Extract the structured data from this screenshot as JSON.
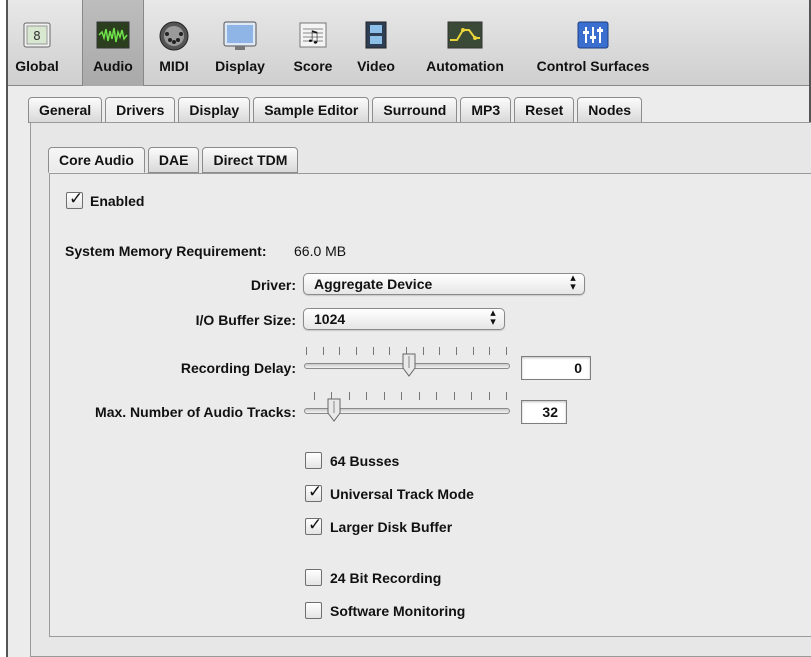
{
  "toolbar": {
    "items": [
      {
        "label": "Global",
        "icon": "global-icon"
      },
      {
        "label": "Audio",
        "icon": "audio-waveform-icon",
        "selected": true
      },
      {
        "label": "MIDI",
        "icon": "midi-connector-icon"
      },
      {
        "label": "Display",
        "icon": "display-monitor-icon"
      },
      {
        "label": "Score",
        "icon": "score-notes-icon"
      },
      {
        "label": "Video",
        "icon": "video-film-icon"
      },
      {
        "label": "Automation",
        "icon": "automation-curve-icon"
      },
      {
        "label": "Control Surfaces",
        "icon": "control-surface-icon"
      }
    ]
  },
  "tabs": {
    "main": [
      "General",
      "Drivers",
      "Display",
      "Sample Editor",
      "Surround",
      "MP3",
      "Reset",
      "Nodes"
    ],
    "main_active": "Drivers",
    "sub": [
      "Core Audio",
      "DAE",
      "Direct TDM"
    ],
    "sub_active": "Core Audio"
  },
  "core_audio": {
    "enabled": {
      "label": "Enabled",
      "checked": true
    },
    "memory_label": "System Memory Requirement:",
    "memory_value": "66.0 MB",
    "driver": {
      "label": "Driver:",
      "value": "Aggregate Device"
    },
    "buffer": {
      "label": "I/O Buffer Size:",
      "value": "1024"
    },
    "recording_delay": {
      "label": "Recording Delay:",
      "value": "0",
      "level": 0.5
    },
    "max_tracks": {
      "label": "Max. Number of Audio Tracks:",
      "value": "32",
      "level": 0.1
    },
    "options": [
      {
        "label": "64 Busses",
        "checked": false
      },
      {
        "label": "Universal Track Mode",
        "checked": true
      },
      {
        "label": "Larger Disk Buffer",
        "checked": true
      },
      {
        "label": "24 Bit Recording",
        "checked": false
      },
      {
        "label": "Software Monitoring",
        "checked": false
      }
    ]
  },
  "colors": {
    "selected_toolbar": "#b2b2b2",
    "panel": "#ebebeb",
    "control_surface_icon": "#3a6fd0"
  }
}
